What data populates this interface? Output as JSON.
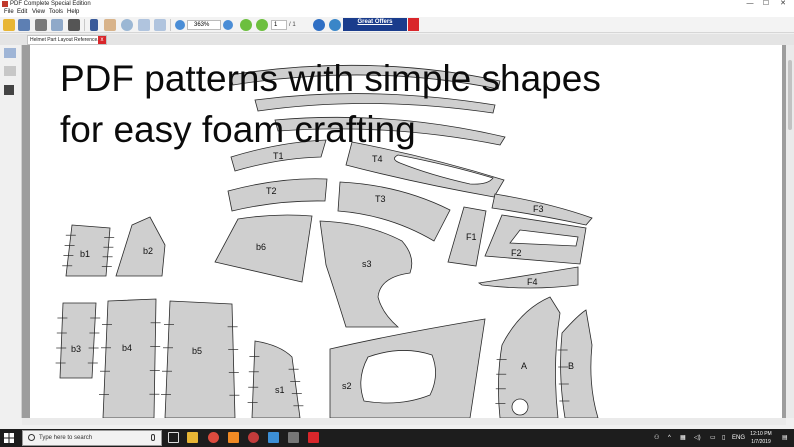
{
  "window": {
    "title": "PDF Complete Special Edition",
    "controls": {
      "minimize": "—",
      "maximize": "☐",
      "close": "✕"
    }
  },
  "menu": [
    "File",
    "Edit",
    "View",
    "Tools",
    "Help"
  ],
  "toolbar": {
    "zoom": "363%",
    "page_current": "1",
    "page_total": "/ 1",
    "ad_label": "Great Offers"
  },
  "tab": {
    "title": "Helmet Part Layout Reference.pdf",
    "close": "x"
  },
  "document": {
    "headline_line1": "PDF patterns with simple shapes",
    "headline_line2": "for easy foam crafting",
    "piece_labels": {
      "t1": "T1",
      "t2": "T2",
      "t3": "T3",
      "t4": "T4",
      "f1": "F1",
      "f2": "F2",
      "f3": "F3",
      "f4": "F4",
      "b1": "b1",
      "b2": "b2",
      "b3": "b3",
      "b4": "b4",
      "b5": "b5",
      "b6": "b6",
      "s1": "s1",
      "s2": "s2",
      "s3": "s3",
      "a": "A",
      "b": "B"
    }
  },
  "taskbar": {
    "search_placeholder": "Type here to search",
    "language": "ENG",
    "time": "12:10 PM",
    "date": "1/7/2019"
  },
  "colors": {
    "ad_bg": "#1a3c8c",
    "accent_red": "#d9262b",
    "piece_fill": "#cfcfcf"
  }
}
